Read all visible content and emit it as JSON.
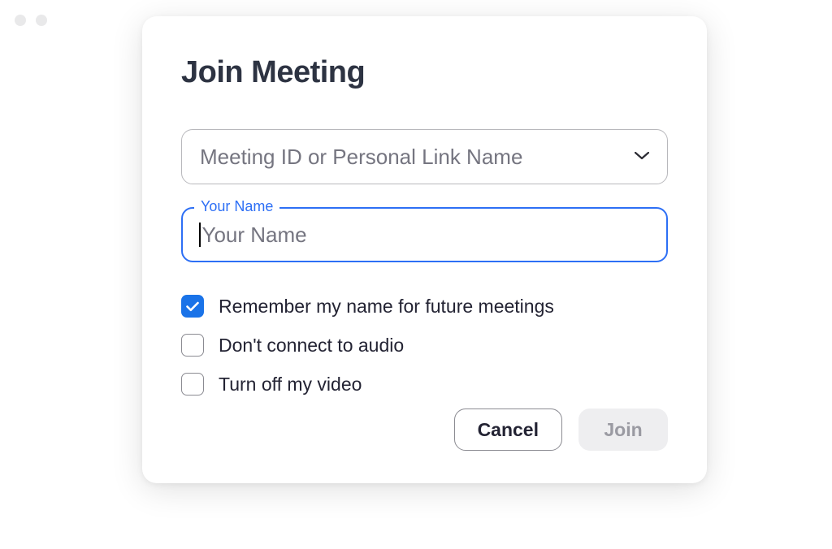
{
  "modal": {
    "title": "Join Meeting",
    "meeting_id": {
      "placeholder": "Meeting ID or Personal Link Name"
    },
    "name_field": {
      "label": "Your Name",
      "placeholder": "Your Name"
    },
    "options": {
      "remember_name": {
        "label": "Remember my name for future meetings",
        "checked": true
      },
      "no_audio": {
        "label": "Don't connect to audio",
        "checked": false
      },
      "no_video": {
        "label": "Turn off my video",
        "checked": false
      }
    },
    "buttons": {
      "cancel": "Cancel",
      "join": "Join"
    }
  }
}
